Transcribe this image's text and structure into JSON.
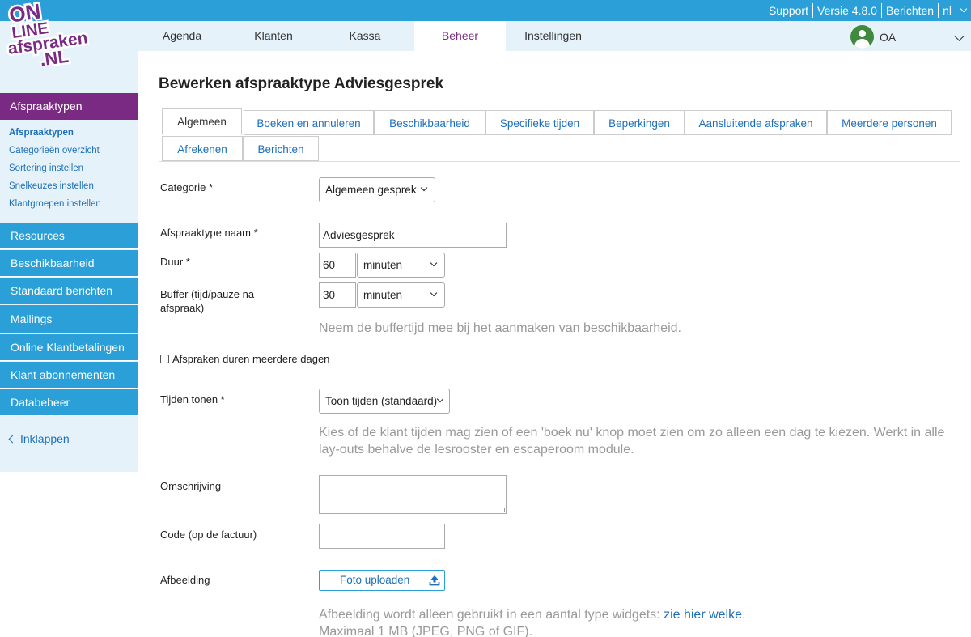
{
  "topbar": {
    "support": "Support",
    "version": "Versie 4.8.0",
    "messages": "Berichten",
    "language": "nl"
  },
  "logo": {
    "line1": "ON",
    "line2": "LINE",
    "line3": "afspraken",
    "line4": ".NL"
  },
  "nav": {
    "tabs": [
      {
        "label": "Agenda"
      },
      {
        "label": "Klanten"
      },
      {
        "label": "Kassa"
      },
      {
        "label": "Beheer",
        "active": true
      },
      {
        "label": "Instellingen"
      }
    ],
    "user_initials": "OA"
  },
  "sidebar": {
    "active_section": "Afspraaktypen",
    "sub_items": [
      {
        "label": "Afspraaktypen",
        "active": true
      },
      {
        "label": "Categorieën overzicht"
      },
      {
        "label": "Sortering instellen"
      },
      {
        "label": "Snelkeuzes instellen"
      },
      {
        "label": "Klantgroepen instellen"
      }
    ],
    "items": [
      {
        "label": "Resources"
      },
      {
        "label": "Beschikbaarheid"
      },
      {
        "label": "Standaard berichten"
      },
      {
        "label": "Mailings"
      },
      {
        "label": "Online Klantbetalingen"
      },
      {
        "label": "Klant abonnementen"
      },
      {
        "label": "Databeheer"
      }
    ],
    "collapse_label": "Inklappen"
  },
  "main": {
    "title": "Bewerken afspraaktype Adviesgesprek",
    "tabs": [
      {
        "label": "Algemeen",
        "active": true
      },
      {
        "label": "Boeken en annuleren"
      },
      {
        "label": "Beschikbaarheid"
      },
      {
        "label": "Specifieke tijden"
      },
      {
        "label": "Beperkingen"
      },
      {
        "label": "Aansluitende afspraken"
      },
      {
        "label": "Meerdere personen"
      },
      {
        "label": "Afrekenen"
      },
      {
        "label": "Berichten"
      }
    ],
    "form": {
      "category_label": "Categorie *",
      "category_value": "Algemeen gesprek",
      "name_label": "Afspraaktype naam *",
      "name_value": "Adviesgesprek",
      "duration_label": "Duur *",
      "duration_value": "60",
      "duration_unit": "minuten",
      "buffer_label_line1": "Buffer (tijd/pauze na",
      "buffer_label_line2": "afspraak)",
      "buffer_value": "30",
      "buffer_unit": "minuten",
      "buffer_hint": "Neem de buffertijd mee bij het aanmaken van beschikbaarheid.",
      "multiday_label": "Afspraken duren meerdere dagen",
      "show_times_label": "Tijden tonen *",
      "show_times_value": "Toon tijden (standaard)",
      "show_times_hint_line1": "Kies of de klant tijden mag zien of een 'boek nu' knop moet zien om zo alleen een dag te kiezen. Werkt in alle",
      "show_times_hint_line2": "lay-outs behalve de lesrooster en escaperoom module.",
      "description_label": "Omschrijving",
      "code_label": "Code (op de factuur)",
      "image_label": "Afbeelding",
      "upload_label": "Foto uploaden",
      "image_hint_prefix": "Afbeelding wordt alleen gebruikt in een aantal type widgets: ",
      "image_hint_link": "zie hier welke",
      "image_hint_suffix": ".",
      "image_hint_line2": "Maximaal 1 MB (JPEG, PNG of GIF)."
    }
  },
  "colors": {
    "primary_blue": "#2a9fd8",
    "purple": "#7a2a82",
    "light_blue_bg": "#e6f2fa",
    "link": "#1e6fb8",
    "avatar_green": "#3f8a3f"
  }
}
